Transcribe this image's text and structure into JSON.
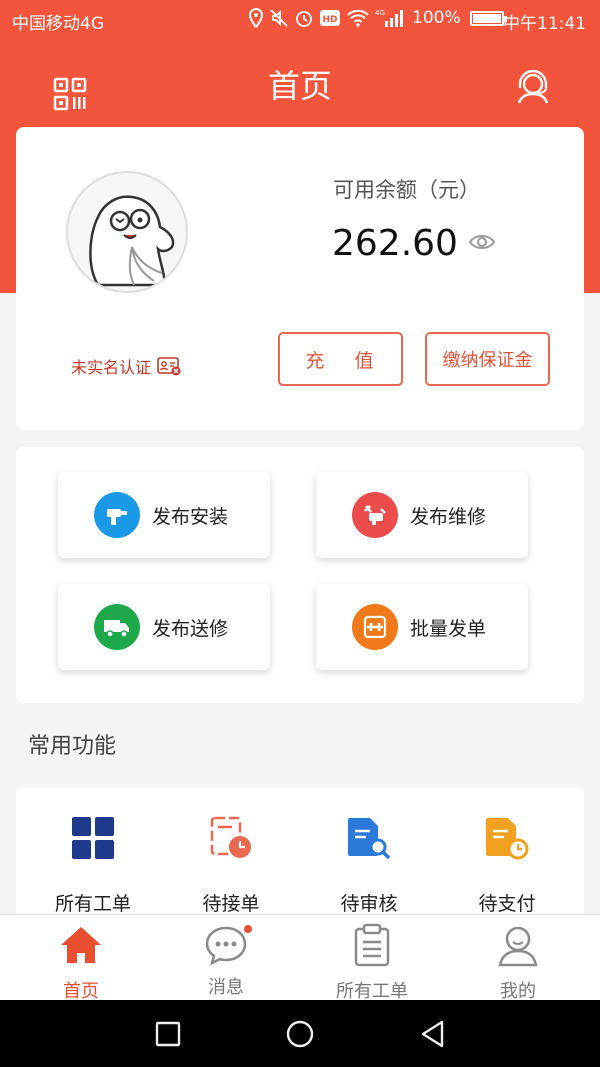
{
  "status_bar": {
    "carrier": "中国移动4G",
    "network_badge": "4G",
    "battery": "100%",
    "time": "中午11:41"
  },
  "header": {
    "title": "首页",
    "left_icon": "qr-code-icon",
    "right_icon": "customer-service-icon"
  },
  "colors": {
    "brand": "#f2553b",
    "accent_text": "#e0553a",
    "install_icon": "#1a9ae6",
    "repair_icon": "#ec4c4c",
    "delivery_icon": "#1ea84a",
    "batch_icon": "#f07a1a"
  },
  "balance": {
    "label": "可用余额（元）",
    "amount": "262.60",
    "verify_text": "未实名认证",
    "recharge_label": "充 值",
    "deposit_label": "缴纳保证金"
  },
  "publish": [
    {
      "label": "发布安装",
      "icon": "drill-icon"
    },
    {
      "label": "发布维修",
      "icon": "repair-icon"
    },
    {
      "label": "发布送修",
      "icon": "truck-icon"
    },
    {
      "label": "批量发单",
      "icon": "batch-add-icon"
    }
  ],
  "common": {
    "title": "常用功能",
    "items": [
      {
        "label": "所有工单",
        "icon": "grid-icon"
      },
      {
        "label": "待接单",
        "icon": "clock-doc-icon"
      },
      {
        "label": "待审核",
        "icon": "search-doc-icon"
      },
      {
        "label": "待支付",
        "icon": "pay-doc-icon"
      }
    ]
  },
  "tabs": [
    {
      "label": "首页",
      "icon": "home-icon",
      "active": true
    },
    {
      "label": "消息",
      "icon": "message-icon",
      "badge": true
    },
    {
      "label": "所有工单",
      "icon": "orders-icon"
    },
    {
      "label": "我的",
      "icon": "profile-icon"
    }
  ]
}
